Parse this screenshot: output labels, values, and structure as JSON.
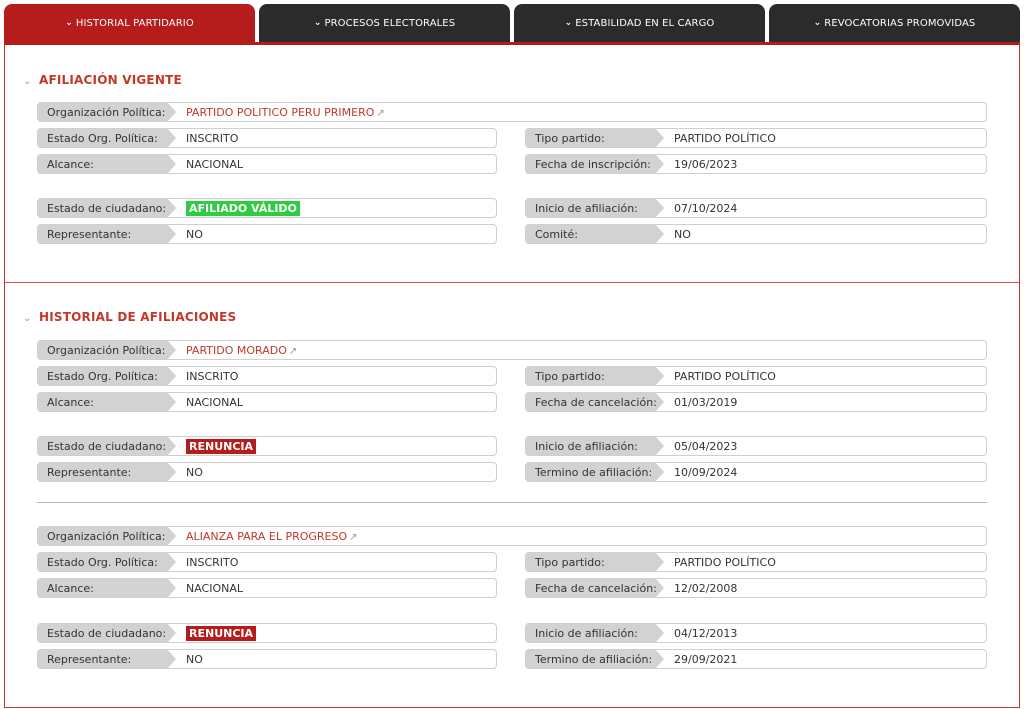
{
  "tabs": [
    {
      "label": "HISTORIAL PARTIDARIO",
      "active": true
    },
    {
      "label": "PROCESOS ELECTORALES",
      "active": false
    },
    {
      "label": "ESTABILIDAD EN EL CARGO",
      "active": false
    },
    {
      "label": "REVOCATORIAS PROMOVIDAS",
      "active": false
    }
  ],
  "current": {
    "title": "AFILIACIÓN VIGENTE",
    "org_label": "Organización Política:",
    "org_value": "PARTIDO POLITICO PERU PRIMERO",
    "estado_org_label": "Estado Org. Política:",
    "estado_org_value": "INSCRITO",
    "tipo_label": "Tipo partido:",
    "tipo_value": "PARTIDO POLÍTICO",
    "alcance_label": "Alcance:",
    "alcance_value": "NACIONAL",
    "fecha_label": "Fecha de inscripción:",
    "fecha_value": "19/06/2023",
    "estado_ciud_label": "Estado de ciudadano:",
    "estado_ciud_value": "AFILIADO VÁLIDO",
    "inicio_label": "Inicio de afiliación:",
    "inicio_value": "07/10/2024",
    "rep_label": "Representante:",
    "rep_value": "NO",
    "comite_label": "Comité:",
    "comite_value": "NO"
  },
  "history": {
    "title": "HISTORIAL DE AFILIACIONES",
    "entries": [
      {
        "org_label": "Organización Política:",
        "org_value": "PARTIDO MORADO",
        "estado_org_label": "Estado Org. Política:",
        "estado_org_value": "INSCRITO",
        "tipo_label": "Tipo partido:",
        "tipo_value": "PARTIDO POLÍTICO",
        "alcance_label": "Alcance:",
        "alcance_value": "NACIONAL",
        "cancel_label": "Fecha de cancelación:",
        "cancel_value": "01/03/2019",
        "estado_ciud_label": "Estado de ciudadano:",
        "estado_ciud_value": "RENUNCIA",
        "inicio_label": "Inicio de afiliación:",
        "inicio_value": "05/04/2023",
        "rep_label": "Representante:",
        "rep_value": "NO",
        "termino_label": "Termino de afiliación:",
        "termino_value": "10/09/2024"
      },
      {
        "org_label": "Organización Política:",
        "org_value": "ALIANZA PARA EL PROGRESO",
        "estado_org_label": "Estado Org. Política:",
        "estado_org_value": "INSCRITO",
        "tipo_label": "Tipo partido:",
        "tipo_value": "PARTIDO POLÍTICO",
        "alcance_label": "Alcance:",
        "alcance_value": "NACIONAL",
        "cancel_label": "Fecha de cancelación:",
        "cancel_value": "12/02/2008",
        "estado_ciud_label": "Estado de ciudadano:",
        "estado_ciud_value": "RENUNCIA",
        "inicio_label": "Inicio de afiliación:",
        "inicio_value": "04/12/2013",
        "rep_label": "Representante:",
        "rep_value": "NO",
        "termino_label": "Termino de afiliación:",
        "termino_value": "29/09/2021"
      }
    ]
  },
  "colors": {
    "accent": "#b51d1d",
    "tab_bg": "#2b2b2b",
    "valid": "#2ecc40"
  },
  "icons": {
    "chevron": "chevron-down-icon",
    "external": "external-link-icon"
  }
}
